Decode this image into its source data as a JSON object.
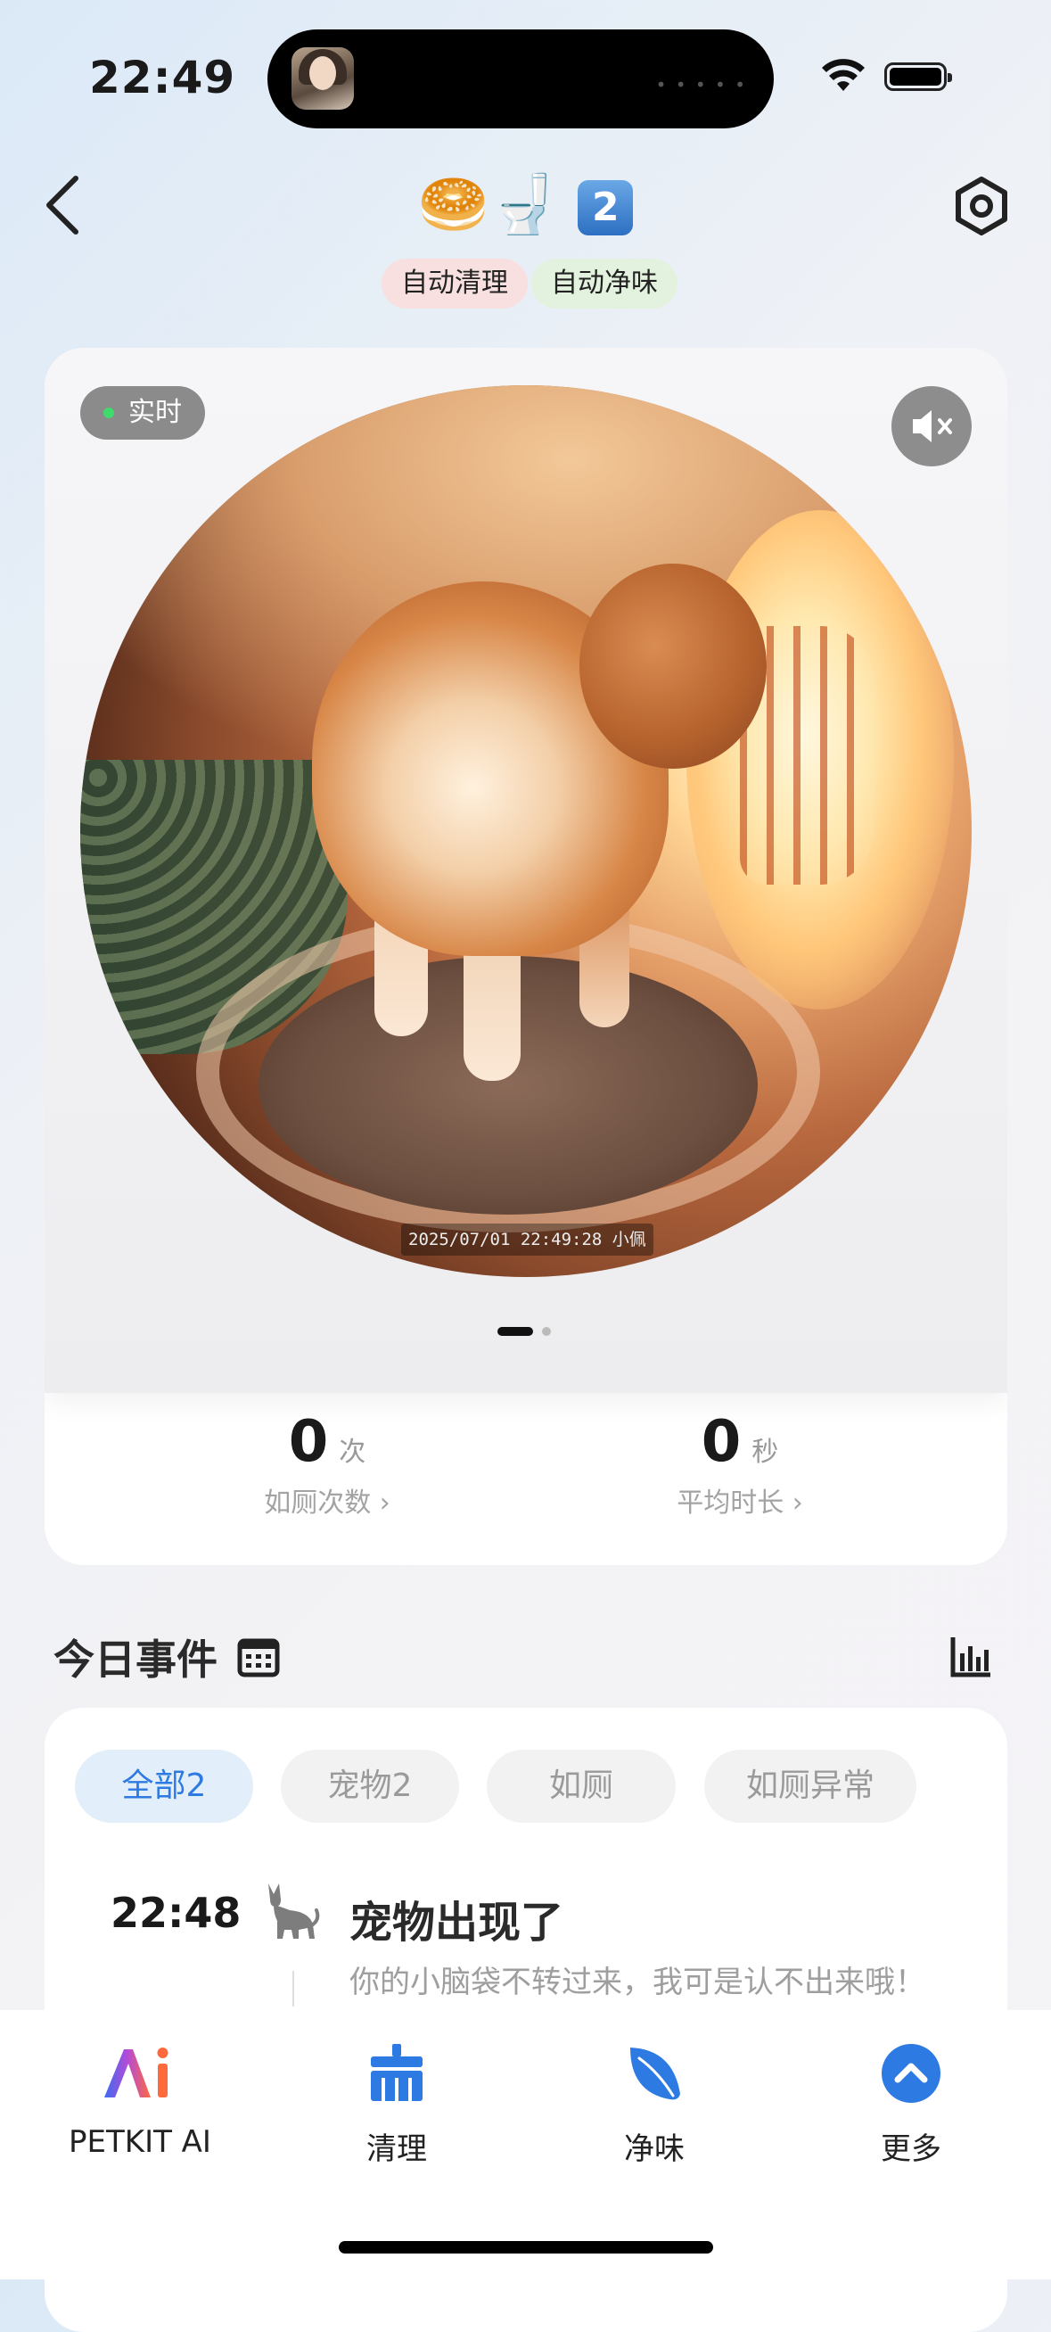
{
  "status_bar": {
    "time": "22:49"
  },
  "header": {
    "title_emoji": "🥯🚽",
    "title_number": "2",
    "tags": [
      "自动清理",
      "自动净味"
    ]
  },
  "camera": {
    "live_label": "实时",
    "timestamp_overlay": "2025/07/01  22:49:28  小佩"
  },
  "stats": [
    {
      "value": "0",
      "unit": "次",
      "label": "如厕次数 ›"
    },
    {
      "value": "0",
      "unit": "秒",
      "label": "平均时长 ›"
    }
  ],
  "events": {
    "title": "今日事件",
    "filters": [
      {
        "label": "全部2",
        "active": true
      },
      {
        "label": "宠物2",
        "active": false
      },
      {
        "label": "如厕",
        "active": false
      },
      {
        "label": "如厕异常",
        "active": false
      }
    ],
    "items": [
      {
        "time": "22:48",
        "name": "宠物出现了",
        "desc": "你的小脑袋不转过来，我可是认不出来哦！"
      }
    ]
  },
  "tabbar": [
    {
      "label": "PETKIT AI",
      "icon": "petkit-ai-icon"
    },
    {
      "label": "清理",
      "icon": "broom-icon"
    },
    {
      "label": "净味",
      "icon": "leaf-icon"
    },
    {
      "label": "更多",
      "icon": "chevron-up-circle-icon"
    }
  ],
  "colors": {
    "accent": "#2d7be2",
    "live_dot": "#3fdc6d"
  }
}
